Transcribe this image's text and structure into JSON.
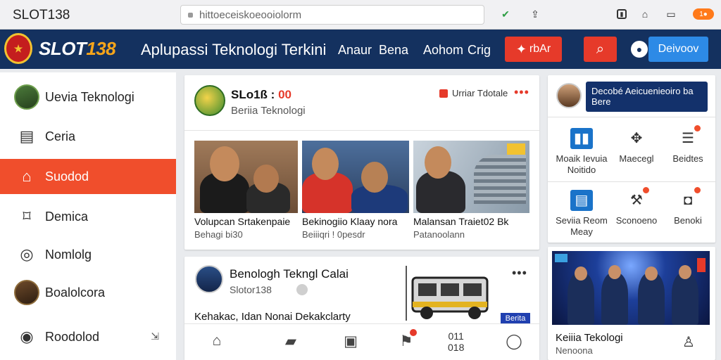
{
  "browser": {
    "tab_title": "SLOT138",
    "url": "hittoeceiskoeooiolorm",
    "icons": [
      "shield-check-icon",
      "share-icon",
      "reader-icon",
      "home-icon",
      "wallet-icon"
    ],
    "badge": "1●"
  },
  "header": {
    "brand_prefix": "SLOT",
    "brand_suffix": "138",
    "title": "Aplupassi Teknologi Terkini",
    "links": [
      "Anaur",
      "Bena",
      "Aohom",
      "Crig"
    ],
    "action_button": "rbAr",
    "right_button": "Deivoov"
  },
  "sidebar": {
    "items": [
      {
        "label": "Uevia Teknologi",
        "icon": "user-avatar-icon"
      },
      {
        "label": "Ceria",
        "icon": "id-card-icon"
      },
      {
        "label": "Suodod",
        "icon": "home-outline-icon",
        "active": true
      },
      {
        "label": "Demica",
        "icon": "tag-icon"
      },
      {
        "label": "Nomlolg",
        "icon": "instagram-icon"
      },
      {
        "label": "Boalolcora",
        "icon": "user-avatar-icon"
      },
      {
        "label": "Roodolod",
        "icon": "location-icon"
      }
    ]
  },
  "post1": {
    "name": "SLo1ß : ",
    "name_accent": "00",
    "subtitle": "Beriia Teknologi",
    "follow_label": "Urriar Tdotale",
    "thumbnails": [
      {
        "title": "Volupcan Srtakenpaie",
        "meta": "Behagi bi30"
      },
      {
        "title": "Bekinogiio Klaay nora",
        "meta": "Beiiiqri ! 0pesdr"
      },
      {
        "title": "Malansan Traiet02 Bk",
        "meta": "Patanoolann"
      }
    ]
  },
  "post2": {
    "name": "Benologh Tekngl Calai",
    "subtitle": "Slotor138",
    "body": "Kehakac, Idan Nonai Dekakclarty",
    "tag": "Berita"
  },
  "bottom_nav": {
    "icons": [
      "home-icon",
      "chat-icon",
      "inbox-icon",
      "notifications-icon",
      "profile-icon"
    ],
    "time_top": "011",
    "time_bottom": "018"
  },
  "right": {
    "banner": "Decobé Aeicuenieoiro ba Bere",
    "grid": [
      {
        "label": "Moaik Ievuia Noitido",
        "icon": "chart-icon"
      },
      {
        "label": "Maecegl",
        "icon": "badge-icon"
      },
      {
        "label": "Beidtes",
        "icon": "layers-icon"
      },
      {
        "label": "Seviia Reom Meay",
        "icon": "document-icon"
      },
      {
        "label": "Sconoeno",
        "icon": "tools-icon"
      },
      {
        "label": "Benoki",
        "icon": "bag-icon"
      }
    ],
    "video_title": "Keiiia Tekologi",
    "video_sub": "Nenoona"
  }
}
